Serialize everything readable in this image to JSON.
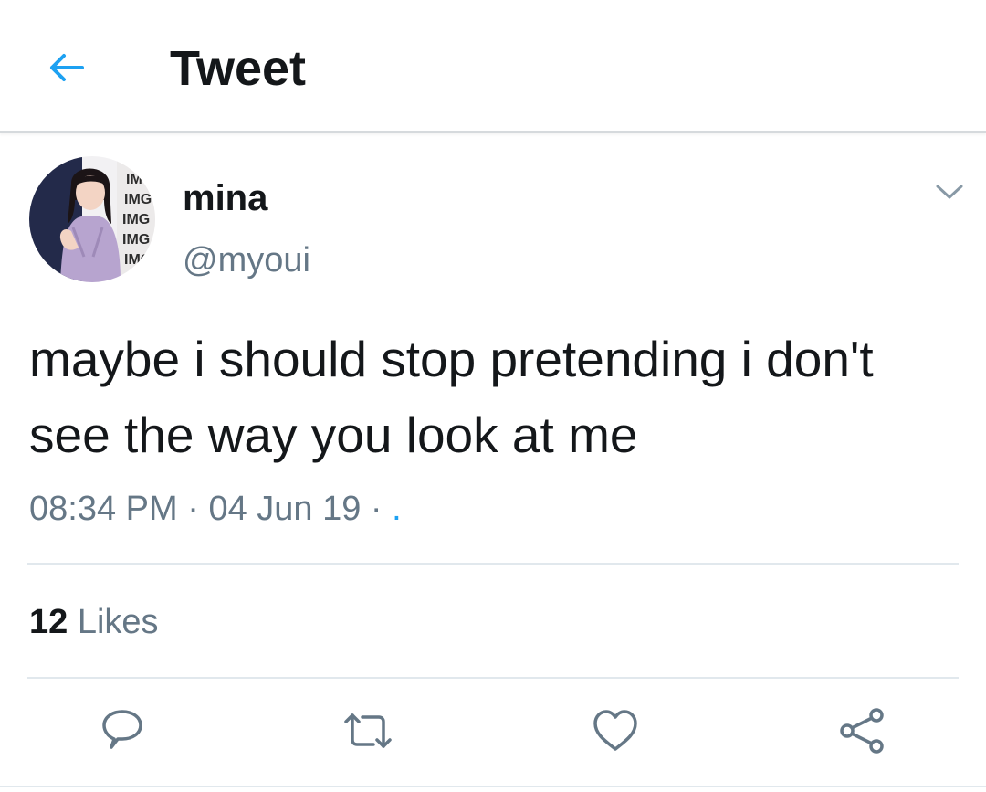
{
  "header": {
    "title": "Tweet",
    "back_icon": "arrow-left-icon"
  },
  "colors": {
    "accent": "#1da1f2",
    "text_primary": "#14171a",
    "text_secondary": "#657786",
    "divider": "#e1e8ed"
  },
  "tweet": {
    "display_name": "mina",
    "handle": "@myoui",
    "avatar_icon": "profile-photo-avatar",
    "avatar_wall_text": "IMG",
    "menu_icon": "chevron-down-icon",
    "text": "maybe i should stop pretending i don't see the way you look at me",
    "time": "08:34 PM",
    "separator": "·",
    "date": "04 Jun 19",
    "source": "."
  },
  "stats": {
    "likes_count": "12",
    "likes_label": "Likes"
  },
  "actions": {
    "reply_icon": "reply-icon",
    "retweet_icon": "retweet-icon",
    "like_icon": "heart-icon",
    "share_icon": "share-icon"
  }
}
